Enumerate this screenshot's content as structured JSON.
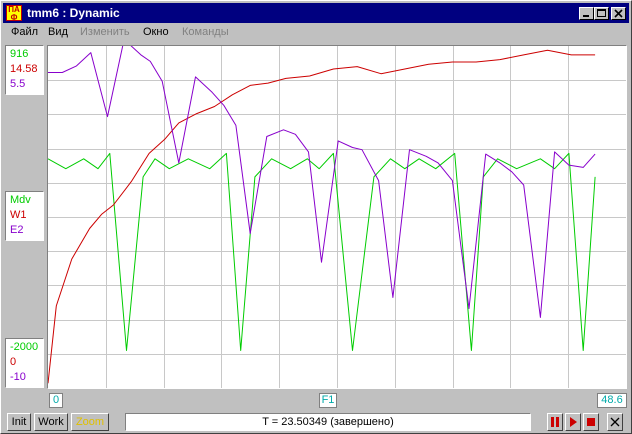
{
  "window": {
    "title": "tmm6 : Dynamic",
    "icon_text": [
      "ПА",
      "Ф"
    ]
  },
  "menu": [
    {
      "label": "Файл",
      "enabled": true
    },
    {
      "label": "Вид",
      "enabled": true
    },
    {
      "label": "Изменить",
      "enabled": false
    },
    {
      "label": "Окно",
      "enabled": true
    },
    {
      "label": "Команды",
      "enabled": false
    }
  ],
  "legend": {
    "max": [
      "916",
      "14.58",
      "5.5"
    ],
    "names": [
      "Mdv",
      "W1",
      "E2"
    ],
    "min": [
      "-2000",
      "0",
      "-10"
    ],
    "colors": [
      "#00cc00",
      "#cc0000",
      "#8800cc"
    ]
  },
  "axis": {
    "x_min": "0",
    "x_label": "F1",
    "x_max": "48.6"
  },
  "buttons": {
    "init": "Init",
    "work": "Work",
    "zoom": "Zoom"
  },
  "status": "T = 23.50349  (завершено)",
  "chart_data": {
    "type": "line",
    "xlim": [
      0,
      48.6
    ],
    "grid": true,
    "series": [
      {
        "name": "Mdv",
        "color": "#00cc00",
        "ylim": [
          -2000,
          916
        ],
        "x": [
          0,
          1.5,
          3,
          4.2,
          5.2,
          6.6,
          8.0,
          9.0,
          10.2,
          11.8,
          13.6,
          15.0,
          16.2,
          17.4,
          18.8,
          20.4,
          21.8,
          22.8,
          24.0,
          25.6,
          27.4,
          28.8,
          30.0,
          31.2,
          32.6,
          34.2,
          35.6,
          36.6,
          37.8,
          39.4,
          41.4,
          42.6,
          43.8,
          45.0,
          46.0
        ],
        "y": [
          -46,
          -130,
          -46,
          -130,
          0,
          -1680,
          -200,
          -46,
          -130,
          -46,
          -130,
          0,
          -1680,
          -200,
          -46,
          -130,
          -46,
          -130,
          0,
          -1680,
          -200,
          -46,
          -130,
          -46,
          -130,
          0,
          -1680,
          -200,
          -46,
          -130,
          -46,
          -130,
          0,
          -1680,
          -200
        ]
      },
      {
        "name": "W1",
        "color": "#cc0000",
        "ylim": [
          0,
          14.58
        ],
        "x": [
          0,
          0.7,
          2,
          3.5,
          4.5,
          5.5,
          7,
          8.5,
          9.8,
          11,
          12.5,
          14,
          15.5,
          17,
          18.5,
          20,
          22,
          24,
          26,
          28,
          30,
          32,
          34,
          36,
          38,
          40,
          42,
          44,
          46
        ],
        "y": [
          0.2,
          3.5,
          5.5,
          6.8,
          7.4,
          7.8,
          8.8,
          10,
          10.6,
          11.3,
          11.7,
          12.0,
          12.5,
          12.9,
          13.0,
          13.2,
          13.3,
          13.6,
          13.7,
          13.4,
          13.6,
          13.8,
          13.9,
          13.9,
          14.0,
          14.2,
          14.4,
          14.2,
          14.2
        ]
      },
      {
        "name": "E2",
        "color": "#8800cc",
        "ylim": [
          -10,
          5.5
        ],
        "x": [
          0,
          1.2,
          2.4,
          3.6,
          5.0,
          6.4,
          7.8,
          8.6,
          9.6,
          11.0,
          12.4,
          13.8,
          14.8,
          15.8,
          17.0,
          18.4,
          19.8,
          20.8,
          21.9,
          23.0,
          24.4,
          25.6,
          26.4,
          27.8,
          29.0,
          30.4,
          31.8,
          32.8,
          34.0,
          35.4,
          36.8,
          38.0,
          39.0,
          40.0,
          41.4,
          42.6,
          43.8,
          45.0,
          46.0
        ],
        "y": [
          4.3,
          4.3,
          4.6,
          5.2,
          2.3,
          5.8,
          5.1,
          4.8,
          3.9,
          0.2,
          4.1,
          3.4,
          2.8,
          1.9,
          -3.0,
          1.4,
          1.7,
          1.5,
          0.7,
          -4.3,
          1.2,
          0.9,
          0.8,
          -0.6,
          -5.9,
          0.8,
          0.5,
          0.2,
          -0.6,
          -6.4,
          0.6,
          0.2,
          -0.2,
          -0.8,
          -6.8,
          0.7,
          0.1,
          0.0,
          0.6
        ]
      }
    ]
  }
}
